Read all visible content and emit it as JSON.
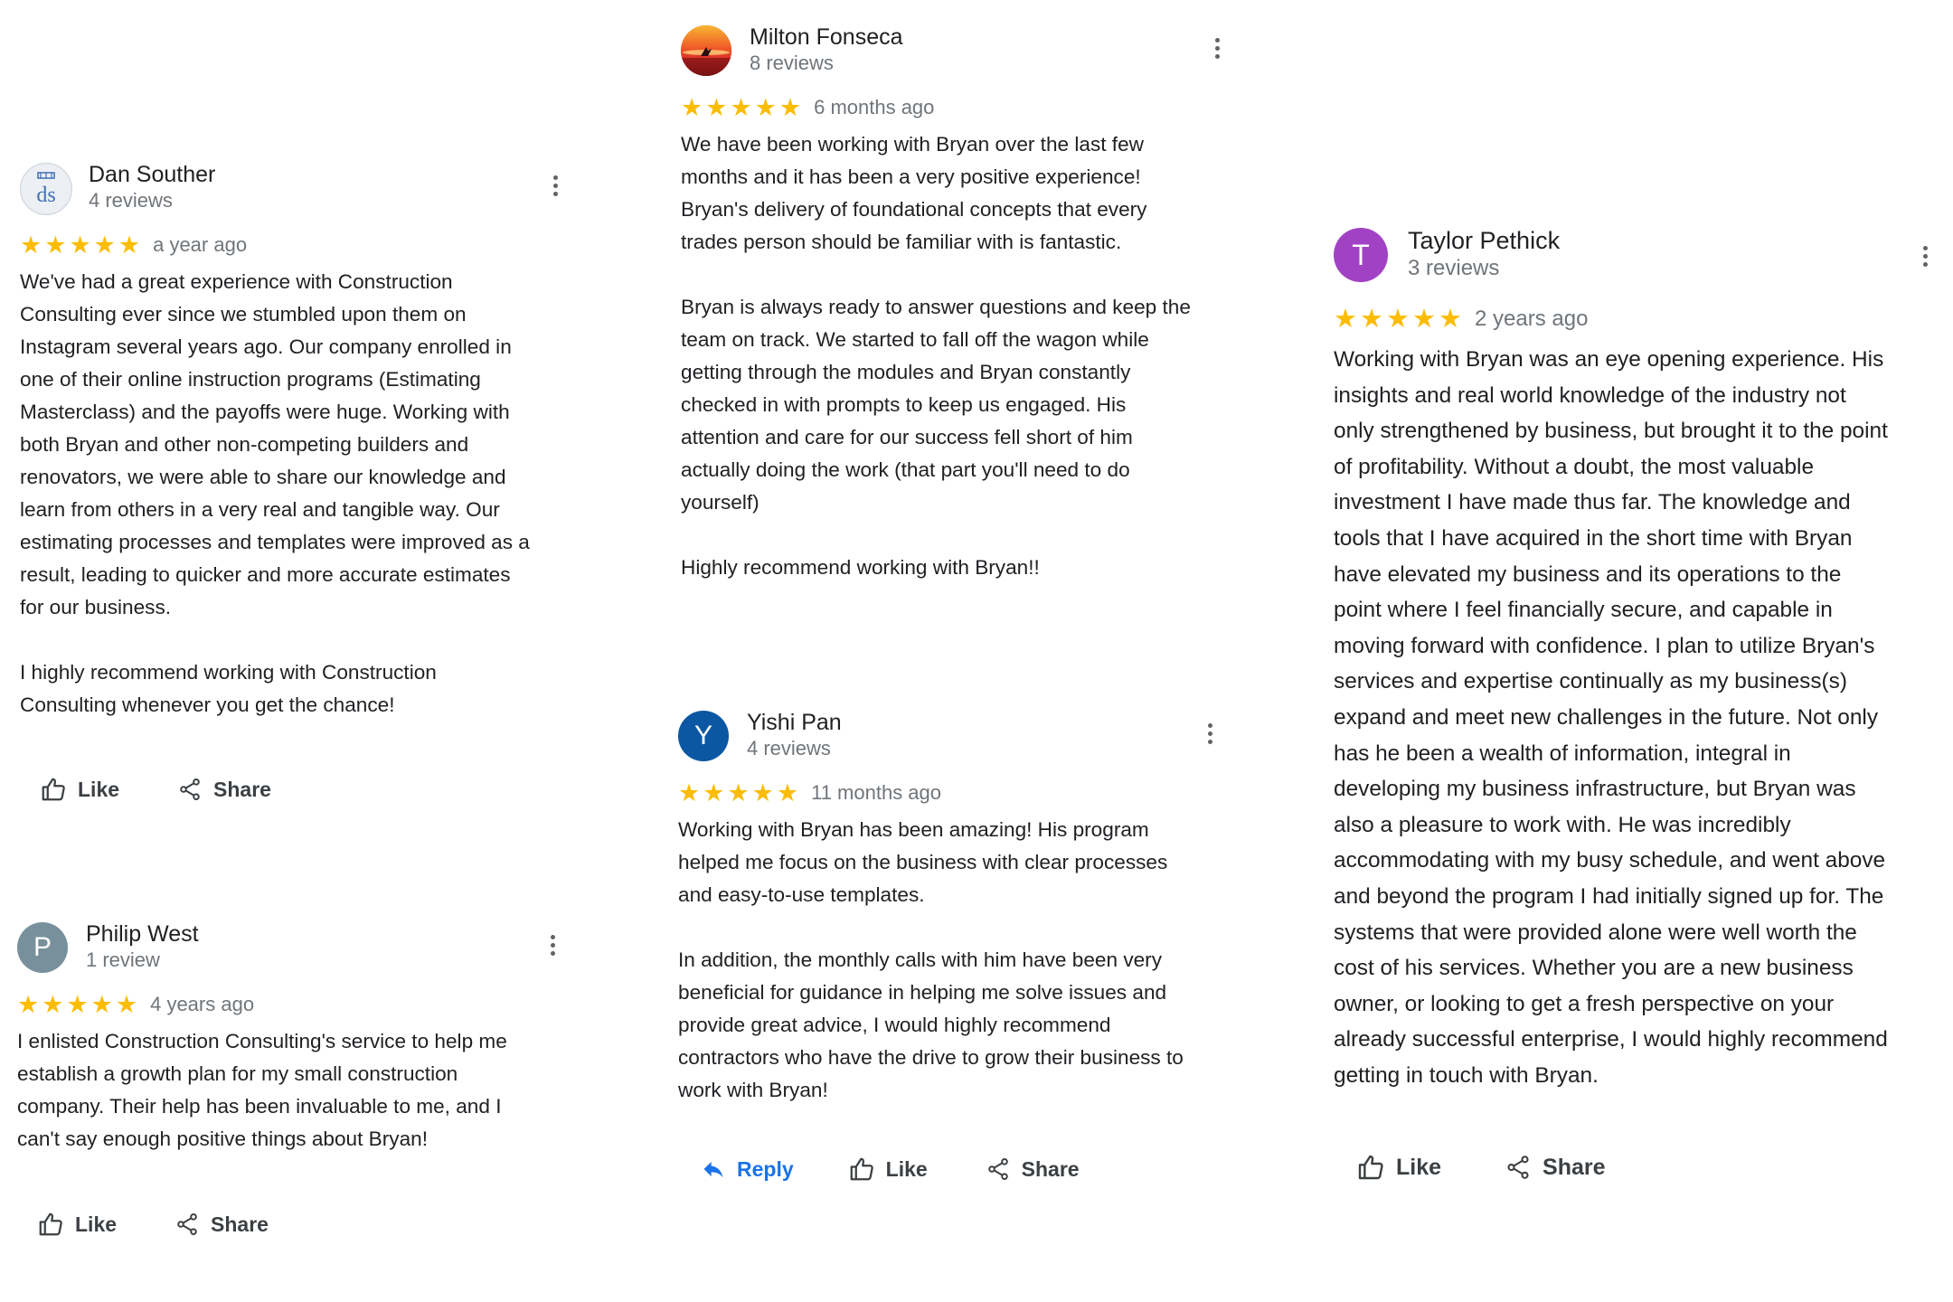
{
  "colors": {
    "star": "#fbbc04",
    "link_blue": "#1a73e8",
    "text": "#202124",
    "muted": "#70757a"
  },
  "actions": {
    "like": "Like",
    "share": "Share",
    "reply": "Reply"
  },
  "reviews": [
    {
      "name": "Dan Souther",
      "count": "4 reviews",
      "avatar": "logo",
      "avatar_logo_text": "ds",
      "rating": 5,
      "time": "a year ago",
      "body": "We've had a great experience with Construction\nConsulting ever since we stumbled upon them on\nInstagram several years ago. Our company enrolled in\none of their online instruction programs (Estimating\nMasterclass) and the payoffs were huge. Working with\nboth Bryan and other non-competing builders and\nrenovators, we were able to share our knowledge and\nlearn from others in a very real and tangible way. Our\nestimating processes and templates were improved as a\nresult, leading to quicker and more accurate estimates\nfor our business.\n\nI highly recommend working with Construction\nConsulting whenever you get the chance!"
    },
    {
      "name": "Philip West",
      "count": "1 review",
      "avatar": "P",
      "avatar_color": "#78909c",
      "rating": 5,
      "time": "4 years ago",
      "body": "I enlisted Construction Consulting's service to help me\nestablish a growth plan for my small construction\ncompany. Their help has been invaluable to me, and I\ncan't say enough positive things about Bryan!"
    },
    {
      "name": "Milton Fonseca",
      "count": "8 reviews",
      "avatar": "photo",
      "rating": 5,
      "time": "6 months ago",
      "body": "We have been working with Bryan over the last few\nmonths and it has been a very positive experience!\nBryan's delivery of foundational concepts that every\ntrades person should be familiar with is fantastic.\n\nBryan is always ready to answer questions and keep the\nteam on track. We started to fall off the wagon while\ngetting through the modules and Bryan constantly\nchecked in with prompts to keep us engaged. His\nattention and care for our success fell short of him\nactually doing the work (that part you'll need to do\nyourself)\n\nHighly recommend working with Bryan!!"
    },
    {
      "name": "Yishi Pan",
      "count": "4 reviews",
      "avatar": "Y",
      "avatar_color": "#0b57a3",
      "rating": 5,
      "time": "11 months ago",
      "body": "Working with Bryan has been amazing! His program\nhelped me focus on the business with clear processes\nand easy-to-use templates.\n\nIn addition, the monthly calls with him have been very\nbeneficial for guidance in helping me solve issues and\nprovide great advice, I would highly recommend\ncontractors who have the drive to grow their business to\nwork with Bryan!"
    },
    {
      "name": "Taylor Pethick",
      "count": "3 reviews",
      "avatar": "T",
      "avatar_color": "#a142c5",
      "rating": 5,
      "time": "2 years ago",
      "body": "Working with Bryan was an eye opening experience. His\ninsights and real world knowledge of the industry not\nonly strengthened by business, but brought it to the point\nof profitability. Without a doubt, the most valuable\ninvestment I have made thus far. The knowledge and\ntools that I have acquired in the short time with Bryan\nhave elevated my business and its operations to the\npoint where I feel financially secure, and capable in\nmoving forward with confidence. I plan to utilize Bryan's\nservices and expertise continually as my business(s)\nexpand and meet new challenges in the future. Not only\nhas he been a wealth of information, integral in\ndeveloping my business infrastructure, but Bryan was\nalso a pleasure to work with. He was incredibly\naccommodating with my busy schedule, and went above\nand beyond the program I had initially signed up for. The\nsystems that were provided alone were well worth the\ncost of his services. Whether you are a new business\nowner, or looking to get a fresh perspective on your\nalready successful enterprise, I would highly recommend\ngetting in touch with Bryan."
    }
  ]
}
